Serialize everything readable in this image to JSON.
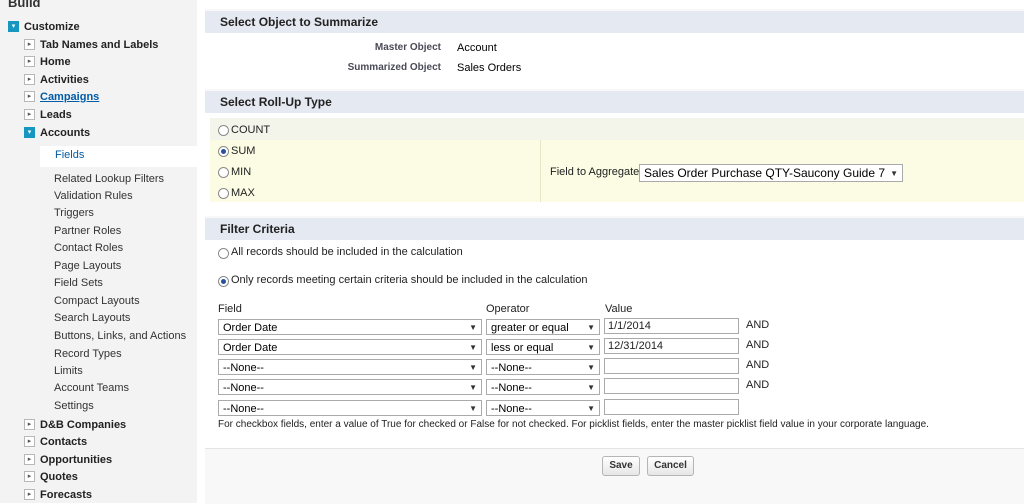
{
  "sidebar": {
    "heading": "Build",
    "customize": "Customize",
    "nodes": [
      {
        "label": "Tab Names and Labels",
        "state": "closed"
      },
      {
        "label": "Home",
        "state": "closed"
      },
      {
        "label": "Activities",
        "state": "closed"
      },
      {
        "label": "Campaigns",
        "state": "closed"
      },
      {
        "label": "Leads",
        "state": "closed"
      },
      {
        "label": "Accounts",
        "state": "open"
      }
    ],
    "account_items": [
      "Fields",
      "Related Lookup Filters",
      "Validation Rules",
      "Triggers",
      "Partner Roles",
      "Contact Roles",
      "Page Layouts",
      "Field Sets",
      "Compact Layouts",
      "Search Layouts",
      "Buttons, Links, and Actions",
      "Record Types",
      "Limits",
      "Account Teams",
      "Settings"
    ],
    "more_nodes": [
      "D&B Companies",
      "Contacts",
      "Opportunities",
      "Quotes",
      "Forecasts"
    ]
  },
  "summarize": {
    "title": "Select Object to Summarize",
    "master_label": "Master Object",
    "master_value": "Account",
    "summarized_label": "Summarized Object",
    "summarized_value": "Sales Orders"
  },
  "rollup": {
    "title": "Select Roll-Up Type",
    "options": [
      "COUNT",
      "SUM",
      "MIN",
      "MAX"
    ],
    "selected": "SUM",
    "field_label": "Field to Aggregate",
    "field_value": "Sales Order Purchase QTY-Saucony Guide 7"
  },
  "filter": {
    "title": "Filter Criteria",
    "option_all": "All records should be included in the calculation",
    "option_some": "Only records meeting certain criteria should be included in the calculation",
    "col_field": "Field",
    "col_operator": "Operator",
    "col_value": "Value",
    "rows": [
      {
        "field": "Order Date",
        "operator": "greater or equal",
        "value": "1/1/2014",
        "conj": "AND"
      },
      {
        "field": "Order Date",
        "operator": "less or equal",
        "value": "12/31/2014",
        "conj": "AND"
      },
      {
        "field": "--None--",
        "operator": "--None--",
        "value": "",
        "conj": "AND"
      },
      {
        "field": "--None--",
        "operator": "--None--",
        "value": "",
        "conj": "AND"
      },
      {
        "field": "--None--",
        "operator": "--None--",
        "value": "",
        "conj": ""
      }
    ],
    "note": "For checkbox fields, enter a value of True for checked or False for not checked. For picklist fields, enter the master picklist field value in your corporate language."
  },
  "buttons": {
    "save": "Save",
    "cancel": "Cancel"
  }
}
